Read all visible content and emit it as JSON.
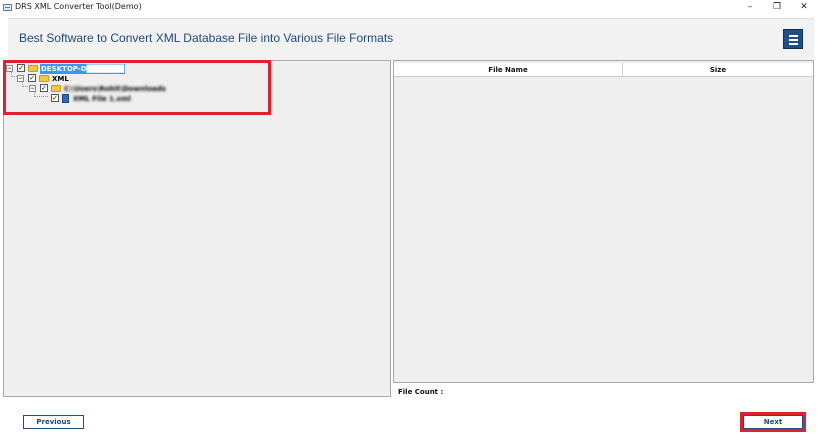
{
  "window": {
    "title": "DRS XML Converter Tool(Demo)",
    "controls": {
      "minimize": "–",
      "restore": "❐",
      "close": "✕"
    }
  },
  "header": {
    "title": "Best Software to Convert XML Database File into Various File Formats",
    "menu_icon": "hamburger-menu-icon",
    "accent_color": "#1e4f86"
  },
  "tree": {
    "nodes": [
      {
        "label": "DESKTOP-D███████",
        "icon": "computer-folder-icon",
        "checked": true,
        "expanded": true,
        "selected": true
      },
      {
        "label": "XML",
        "icon": "folder-icon",
        "checked": true,
        "expanded": true,
        "selected": false
      },
      {
        "label": "C:\\Users\\Rohit\\Downloads",
        "icon": "folder-icon",
        "checked": true,
        "expanded": true,
        "selected": false
      },
      {
        "label": "XML File 1.xml",
        "icon": "xml-file-icon",
        "checked": true,
        "expanded": false,
        "selected": false
      }
    ]
  },
  "grid": {
    "columns": [
      "File Name",
      "Size"
    ],
    "rows": []
  },
  "file_count_label": "File Count :",
  "buttons": {
    "previous": "Previous",
    "next": "Next"
  },
  "highlight_color": "#e0202a"
}
